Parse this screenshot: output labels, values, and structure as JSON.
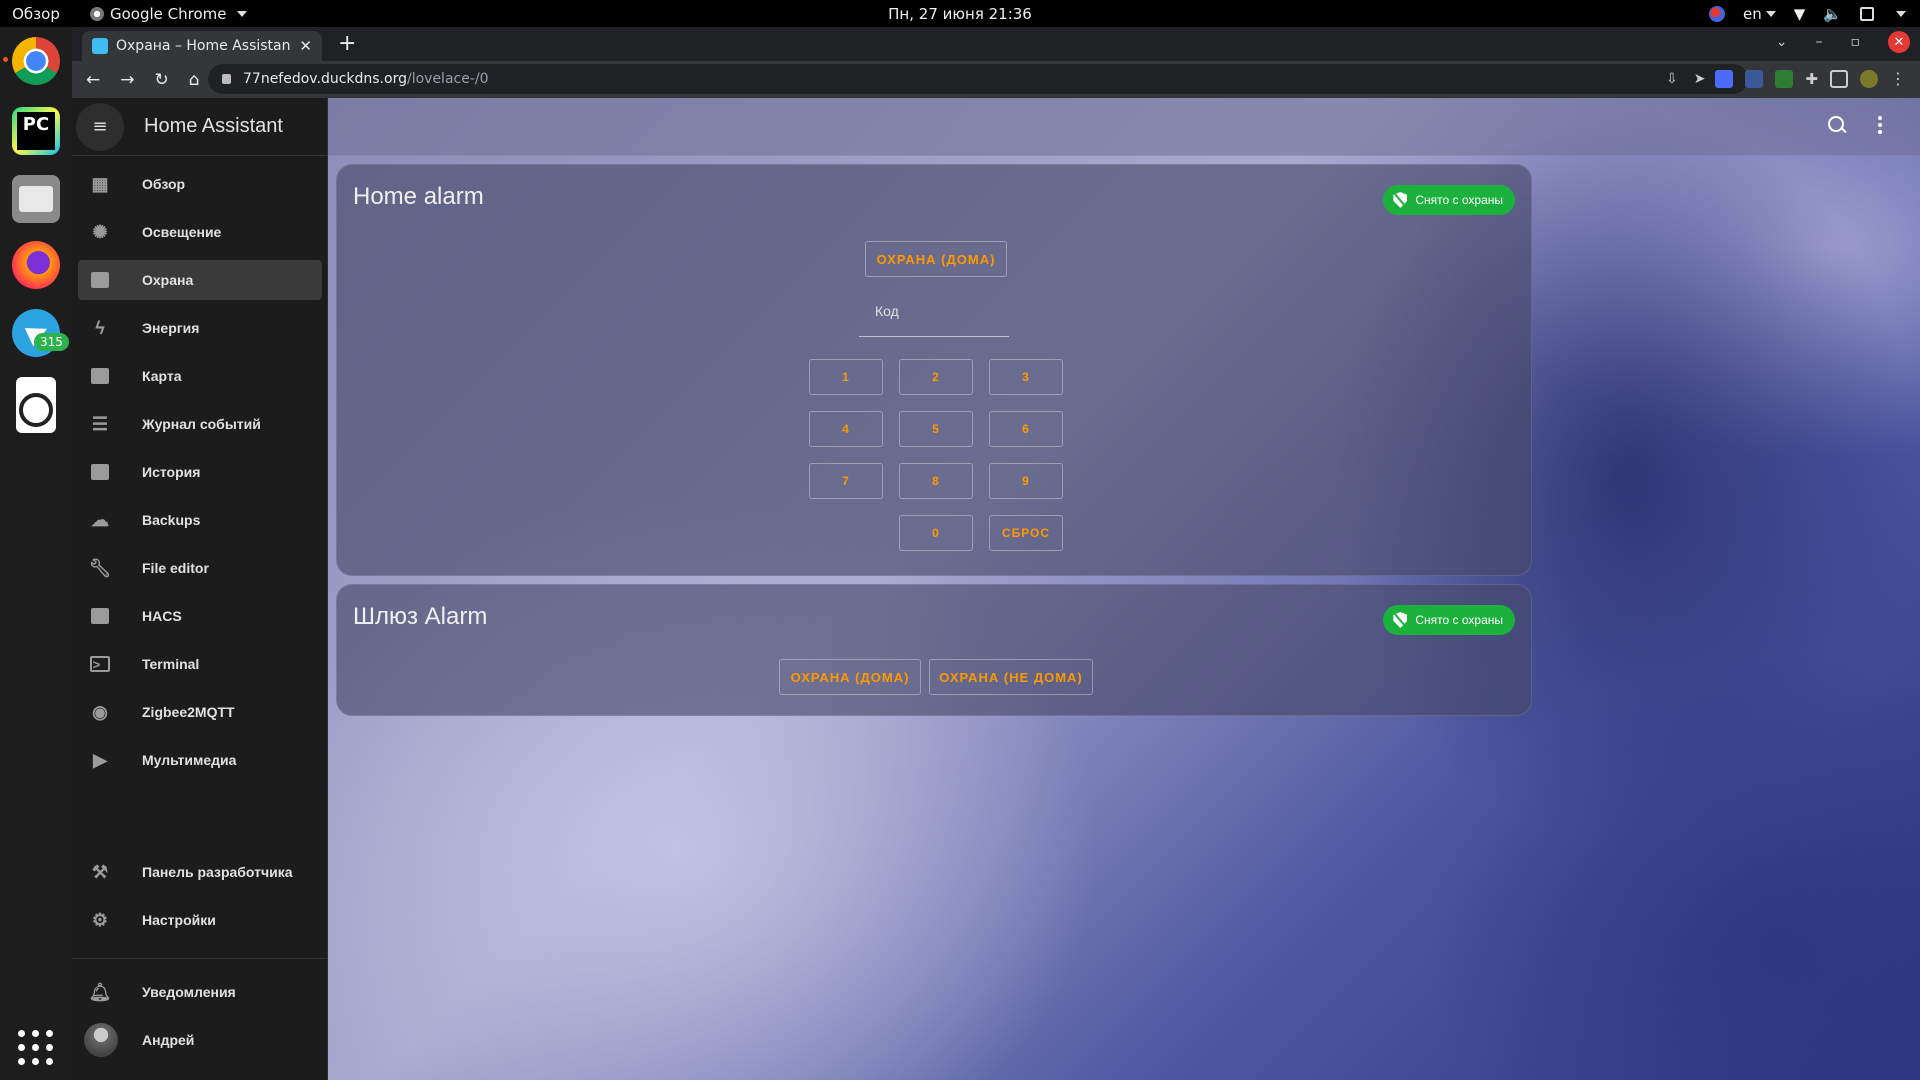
{
  "os": {
    "overview": "Обзор",
    "app_name": "Google Chrome",
    "clock": "Пн, 27 июня  21:36",
    "lang": "en",
    "dock_badge": "315"
  },
  "browser": {
    "tab_title": "Охрана – Home Assistant",
    "url_host": "77nefedov.duckdns.org",
    "url_path": "/lovelace-/0"
  },
  "sidebar": {
    "title": "Home Assistant",
    "items": [
      {
        "label": "Обзор",
        "icon": "dashboard-icon"
      },
      {
        "label": "Освещение",
        "icon": "lightbulb-icon"
      },
      {
        "label": "Охрана",
        "icon": "table-icon"
      },
      {
        "label": "Энергия",
        "icon": "lightning-icon"
      },
      {
        "label": "Карта",
        "icon": "map-account-icon"
      },
      {
        "label": "Журнал событий",
        "icon": "list-icon"
      },
      {
        "label": "История",
        "icon": "chart-icon"
      },
      {
        "label": "Backups",
        "icon": "cloud-icon"
      },
      {
        "label": "File editor",
        "icon": "wrench-icon"
      },
      {
        "label": "HACS",
        "icon": "hacs-icon"
      },
      {
        "label": "Terminal",
        "icon": "console-icon"
      },
      {
        "label": "Zigbee2MQTT",
        "icon": "zigbee-icon"
      },
      {
        "label": "Мультимедиа",
        "icon": "play-box-icon"
      }
    ],
    "developer": "Панель разработчика",
    "settings": "Настройки",
    "notifications": "Уведомления",
    "user": "Андрей"
  },
  "cards": {
    "home_alarm": {
      "title": "Home alarm",
      "state": "Снято с охраны",
      "arm_home": "ОХРАНА (ДОМА)",
      "code_label": "Код",
      "keys": [
        "1",
        "2",
        "3",
        "4",
        "5",
        "6",
        "7",
        "8",
        "9",
        "0"
      ],
      "clear": "СБРОС"
    },
    "gateway_alarm": {
      "title": "Шлюз Alarm",
      "state": "Снято с охраны",
      "arm_home": "ОХРАНА (ДОМА)",
      "arm_away": "ОХРАНА (НЕ ДОМА)"
    }
  },
  "colors": {
    "accent": "#ff9800",
    "disarmed": "#1cb13d",
    "sidebar_bg": "#1c1c1c"
  }
}
